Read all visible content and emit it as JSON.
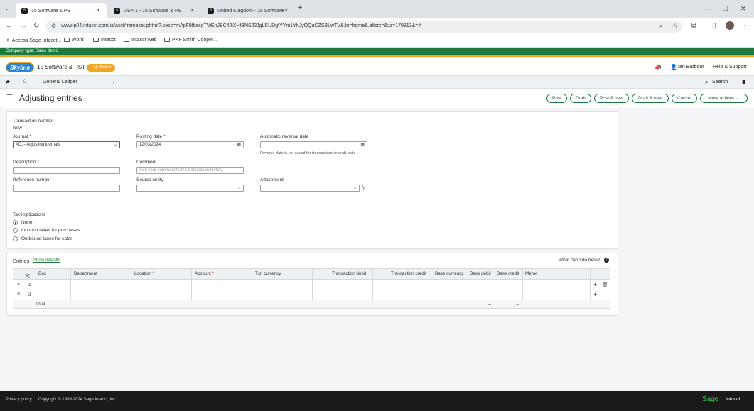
{
  "browser": {
    "tabs": [
      {
        "title": "15 Software & PST"
      },
      {
        "title": "USA 1 - 15 Software & PST"
      },
      {
        "title": "United Kingdom - 15 Software"
      }
    ],
    "url": "www-p04.intacct.com/ia/acct/frameset.phtml?.sess=mApF9fbssgTViEnJBC4JiXHfBNSJ2JgLKUDgfYYm1YhJyQQuCZSBLwTV&.fo=home&.altsrc=&zz=179813&=#",
    "bookmarks": [
      "Access Sage Intacct...",
      "Word",
      "Intacct",
      "Intacct web",
      "PKF Smith Cooper..."
    ]
  },
  "app": {
    "company_type": "Company type: Sales demo",
    "logo": "Skyline",
    "company": "15 Software & PST",
    "level": "Top level",
    "user": "Ian Barbour",
    "help": "Help & Support",
    "module": "General Ledger",
    "search": "Search"
  },
  "page": {
    "title": "Adjusting entries",
    "actions": [
      "Post",
      "Draft",
      "Post & new",
      "Draft & new",
      "Cancel",
      "More actions"
    ]
  },
  "form": {
    "txn_label": "Transaction number",
    "txn_value": "New",
    "journal_label": "Journal",
    "journal_value": "ADJ--Adjusting journals",
    "posting_label": "Posting date",
    "posting_value": "12/03/2024",
    "reversal_label": "Automatic reversal date",
    "reversal_note": "Reverse date is not saved for transactions in draft state",
    "description_label": "Description",
    "comment_label": "Comment",
    "comment_placeholder": "Add your comment to the transaction history",
    "reference_label": "Reference number",
    "source_label": "Source entity",
    "attachment_label": "Attachment",
    "tax_label": "Tax implications",
    "tax_options": [
      "None",
      "Inbound taxes for purchases",
      "Outbound taxes for sales"
    ],
    "tax_selected": 0
  },
  "entries": {
    "title": "Entries",
    "show_defaults": "Show defaults",
    "help": "What can I do here?",
    "columns": [
      "Doc",
      "Department",
      "Location",
      "Account",
      "Txn currency",
      "Transaction debit",
      "Transaction credit",
      "Base currency",
      "Base debit",
      "Base credit",
      "Memo"
    ],
    "rows": [
      {
        "num": "1",
        "base_currency": "--",
        "base_debit": "--",
        "base_credit": "--"
      },
      {
        "num": "2",
        "base_currency": "--",
        "base_debit": "--",
        "base_credit": "--"
      }
    ],
    "total": {
      "label": "Total",
      "base_debit": "--",
      "base_credit": "--"
    }
  },
  "footer": {
    "privacy": "Privacy policy",
    "copyright": "Copyright © 1999-2024 Sage Intacct, Inc.",
    "brand1": "Sage",
    "brand2": "Intacct"
  }
}
